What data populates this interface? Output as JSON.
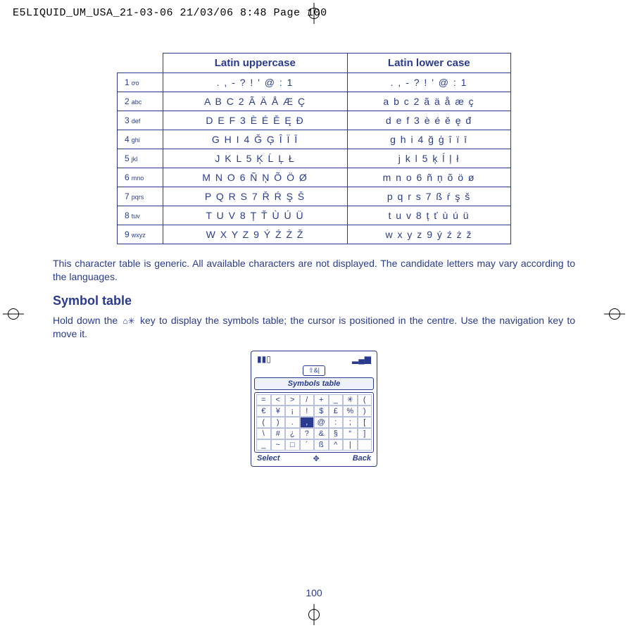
{
  "page_header": "E5LIQUID_UM_USA_21-03-06  21/03/06  8:48  Page 100",
  "char_table": {
    "columns": [
      "Latin uppercase",
      "Latin lower case"
    ],
    "rows": [
      {
        "key_num": "1",
        "key_label": "ơo",
        "upper": ". , - ? ! ' @ : 1",
        "lower": ". , - ? ! ' @ : 1"
      },
      {
        "key_num": "2",
        "key_label": "abc",
        "upper": "A B C 2 Ã Ä Å Æ Ç",
        "lower": "a b c 2 ã ä å æ ç"
      },
      {
        "key_num": "3",
        "key_label": "def",
        "upper": "D E F 3 È É Ě Ę Đ",
        "lower": "d e f 3 è é ě ę đ"
      },
      {
        "key_num": "4",
        "key_label": "ghi",
        "upper": "G H I 4 Ğ Ģ Î Ï Ī",
        "lower": "g h i 4 ğ ģ î ï ī"
      },
      {
        "key_num": "5",
        "key_label": "jkl",
        "upper": "J K L 5 Ķ Ĺ Ļ Ł",
        "lower": "j k l 5 ķ ĺ ļ ł"
      },
      {
        "key_num": "6",
        "key_label": "mno",
        "upper": "M N O 6 Ñ Ņ Õ Ö Ø",
        "lower": "m n o 6 ñ ņ õ ö ø"
      },
      {
        "key_num": "7",
        "key_label": "pqrs",
        "upper": "P Q R S 7 Ř Ŕ Ş Š",
        "lower": "p q r s 7 ß ŕ ş š"
      },
      {
        "key_num": "8",
        "key_label": "tuv",
        "upper": "T U V 8 Ț Ť Ù Ú Ü",
        "lower": "t u v 8 ț ť ù ú ü"
      },
      {
        "key_num": "9",
        "key_label": "wxyz",
        "upper": "W X Y Z 9 Ý Ź Ż Ž",
        "lower": "w x y z 9 ý ź ż ž"
      }
    ]
  },
  "note_text": "This character table is generic. All available characters are not displayed. The candidate letters may vary according to the languages.",
  "section_heading": "Symbol table",
  "symbol_intro_before": "Hold down the ",
  "symbol_key_glyph": "⌂✳",
  "symbol_intro_after": " key to display the symbols table; the cursor is positioned in the centre. Use the navigation key to move it.",
  "phone": {
    "battery_icon": "▮▮▯",
    "signal_icon": "▂▄▆",
    "caps_indicator": "⇧&|",
    "title": "Symbols table",
    "grid": [
      [
        "=",
        "<",
        ">",
        "/",
        "+",
        "_",
        "✳",
        "("
      ],
      [
        "€",
        "¥",
        "¡",
        "!",
        "$",
        "£",
        "%",
        ")"
      ],
      [
        "(",
        ")",
        ".",
        ",",
        "@",
        ":",
        ";",
        "["
      ],
      [
        "\\",
        "#",
        "¿",
        "?",
        "&",
        "§",
        "“",
        "]"
      ],
      [
        "_",
        "~",
        "□",
        "´",
        "ß",
        "^",
        "|",
        ""
      ]
    ],
    "selected": [
      2,
      3
    ],
    "left_soft": "Select",
    "nav_glyph": "✥",
    "right_soft": "Back"
  },
  "page_number": "100"
}
